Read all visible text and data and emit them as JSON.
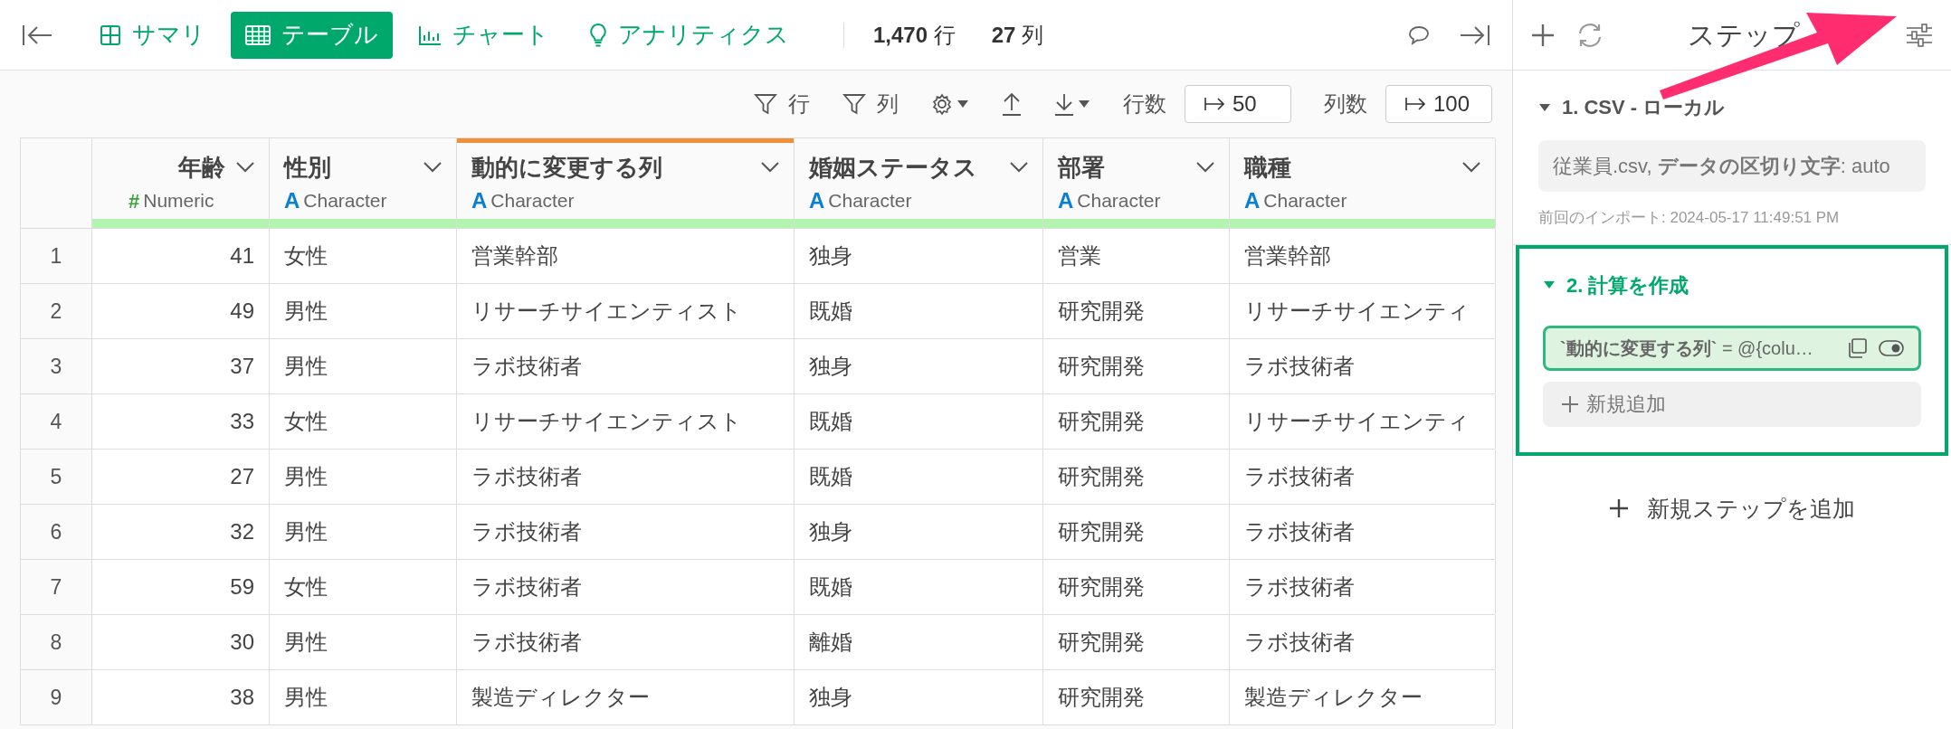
{
  "toolbar": {
    "views": [
      {
        "label": "サマリ",
        "kind": "summary",
        "selected": false
      },
      {
        "label": "テーブル",
        "kind": "table",
        "selected": true
      },
      {
        "label": "チャート",
        "kind": "chart",
        "selected": false
      },
      {
        "label": "アナリティクス",
        "kind": "analytics",
        "selected": false
      }
    ],
    "row_count": "1,470",
    "row_unit": "行",
    "column_count": "27",
    "column_unit": "列"
  },
  "table_toolbar": {
    "row_filter": "行",
    "column_filter": "列",
    "rows_label": "行数",
    "rows_value": "50",
    "columns_label": "列数",
    "columns_value": "100"
  },
  "table": {
    "columns": [
      {
        "name": "年齢",
        "type_symbol": "#",
        "type": "Numeric",
        "kind": "numeric",
        "highlighted": false
      },
      {
        "name": "性別",
        "type_symbol": "A",
        "type": "Character",
        "kind": "character",
        "highlighted": false
      },
      {
        "name": "動的に変更する列",
        "type_symbol": "A",
        "type": "Character",
        "kind": "character",
        "highlighted": true
      },
      {
        "name": "婚姻ステータス",
        "type_symbol": "A",
        "type": "Character",
        "kind": "character",
        "highlighted": false
      },
      {
        "name": "部署",
        "type_symbol": "A",
        "type": "Character",
        "kind": "character",
        "highlighted": false
      },
      {
        "name": "職種",
        "type_symbol": "A",
        "type": "Character",
        "kind": "character",
        "highlighted": false
      }
    ],
    "rows": [
      {
        "index": "1",
        "cells": [
          "41",
          "女性",
          "営業幹部",
          "独身",
          "営業",
          "営業幹部"
        ]
      },
      {
        "index": "2",
        "cells": [
          "49",
          "男性",
          "リサーチサイエンティスト",
          "既婚",
          "研究開発",
          "リサーチサイエンティ"
        ]
      },
      {
        "index": "3",
        "cells": [
          "37",
          "男性",
          "ラボ技術者",
          "独身",
          "研究開発",
          "ラボ技術者"
        ]
      },
      {
        "index": "4",
        "cells": [
          "33",
          "女性",
          "リサーチサイエンティスト",
          "既婚",
          "研究開発",
          "リサーチサイエンティ"
        ]
      },
      {
        "index": "5",
        "cells": [
          "27",
          "男性",
          "ラボ技術者",
          "既婚",
          "研究開発",
          "ラボ技術者"
        ]
      },
      {
        "index": "6",
        "cells": [
          "32",
          "男性",
          "ラボ技術者",
          "独身",
          "研究開発",
          "ラボ技術者"
        ]
      },
      {
        "index": "7",
        "cells": [
          "59",
          "女性",
          "ラボ技術者",
          "既婚",
          "研究開発",
          "ラボ技術者"
        ]
      },
      {
        "index": "8",
        "cells": [
          "30",
          "男性",
          "ラボ技術者",
          "離婚",
          "研究開発",
          "ラボ技術者"
        ]
      },
      {
        "index": "9",
        "cells": [
          "38",
          "男性",
          "製造ディレクター",
          "独身",
          "研究開発",
          "製造ディレクター"
        ]
      }
    ]
  },
  "steps_panel": {
    "title": "ステップ",
    "steps": [
      {
        "title": "1. CSV - ローカル",
        "expanded": true,
        "selected": false,
        "summary": "従業員.csv, **データの区切り文字**: auto",
        "note": "前回のインポート: 2024-05-17 11:49:51 PM"
      },
      {
        "title": "2. 計算を作成",
        "expanded": true,
        "selected": true,
        "items": [
          {
            "formula": "**`動的に変更する列`** = @{colu…",
            "enabled": true
          }
        ],
        "add_label": "新規追加"
      }
    ],
    "add_step_label": "新規ステップを追加"
  },
  "annotation": {
    "kind": "arrow",
    "color": "#ff2d6f"
  }
}
